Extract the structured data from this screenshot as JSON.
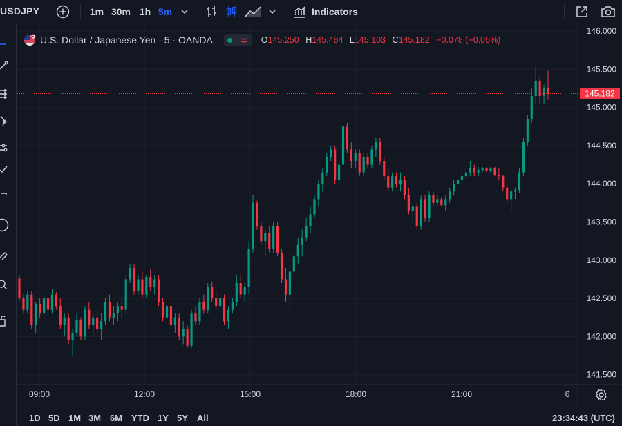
{
  "toolbar": {
    "symbol": "USDJPY",
    "timeframes": [
      "1m",
      "30m",
      "1h",
      "5m"
    ],
    "active_timeframe": "5m",
    "indicators_label": "Indicators"
  },
  "legend": {
    "title": "U.S. Dollar / Japanese Yen · 5 · OANDA",
    "o_label": "O",
    "o_value": "145.250",
    "h_label": "H",
    "h_value": "145.484",
    "l_label": "L",
    "l_value": "145.103",
    "c_label": "C",
    "c_value": "145.182",
    "change": "−0.078 (−0.05%)"
  },
  "ranges": [
    "1D",
    "5D",
    "1M",
    "3M",
    "6M",
    "YTD",
    "1Y",
    "5Y",
    "All"
  ],
  "clock": "23:34:43 (UTC)",
  "colors": {
    "up": "#089981",
    "down": "#f23645",
    "accent": "#2962ff",
    "bg": "#131722",
    "grid": "#1e222d"
  },
  "chart_data": {
    "type": "candlestick",
    "price_axis_labels": [
      "146.000",
      "145.500",
      "145.000",
      "144.500",
      "144.000",
      "143.500",
      "143.000",
      "142.500",
      "142.000",
      "141.500"
    ],
    "time_axis_labels": [
      "09:00",
      "12:00",
      "15:00",
      "18:00",
      "21:00",
      "6"
    ],
    "y_range": [
      141.45,
      146.0
    ],
    "last_price_label": "145.182",
    "candles": [
      [
        142.76,
        142.8,
        142.45,
        142.5
      ],
      [
        142.5,
        142.55,
        142.3,
        142.35
      ],
      [
        142.35,
        142.6,
        142.3,
        142.55
      ],
      [
        142.55,
        142.6,
        142.1,
        142.15
      ],
      [
        142.15,
        142.45,
        142.05,
        142.42
      ],
      [
        142.42,
        142.5,
        142.25,
        142.3
      ],
      [
        142.3,
        142.55,
        142.25,
        142.5
      ],
      [
        142.5,
        142.52,
        142.3,
        142.35
      ],
      [
        142.35,
        142.62,
        142.3,
        142.55
      ],
      [
        142.55,
        142.58,
        142.35,
        142.4
      ],
      [
        142.4,
        142.5,
        142.1,
        142.15
      ],
      [
        142.15,
        142.3,
        142.0,
        142.25
      ],
      [
        142.25,
        142.3,
        141.9,
        141.95
      ],
      [
        141.95,
        142.1,
        141.75,
        142.05
      ],
      [
        142.05,
        142.3,
        142.0,
        142.22
      ],
      [
        142.22,
        142.25,
        141.95,
        142.0
      ],
      [
        142.0,
        142.4,
        141.95,
        142.35
      ],
      [
        142.35,
        142.45,
        142.1,
        142.15
      ],
      [
        142.15,
        142.3,
        142.0,
        142.25
      ],
      [
        142.25,
        142.35,
        142.05,
        142.1
      ],
      [
        142.1,
        142.3,
        141.95,
        142.2
      ],
      [
        142.2,
        142.5,
        142.15,
        142.45
      ],
      [
        142.45,
        142.55,
        142.2,
        142.25
      ],
      [
        142.25,
        142.4,
        142.15,
        142.3
      ],
      [
        142.3,
        142.45,
        142.2,
        142.4
      ],
      [
        142.4,
        142.5,
        142.25,
        142.35
      ],
      [
        142.35,
        142.8,
        142.3,
        142.75
      ],
      [
        142.75,
        142.95,
        142.7,
        142.9
      ],
      [
        142.9,
        142.95,
        142.55,
        142.6
      ],
      [
        142.6,
        142.8,
        142.55,
        142.75
      ],
      [
        142.75,
        142.85,
        142.5,
        142.55
      ],
      [
        142.55,
        142.8,
        142.5,
        142.78
      ],
      [
        142.78,
        142.88,
        142.6,
        142.65
      ],
      [
        142.65,
        142.8,
        142.55,
        142.75
      ],
      [
        142.75,
        142.8,
        142.4,
        142.45
      ],
      [
        142.45,
        142.5,
        142.2,
        142.25
      ],
      [
        142.25,
        142.45,
        142.15,
        142.4
      ],
      [
        142.4,
        142.45,
        142.1,
        142.15
      ],
      [
        142.15,
        142.3,
        142.05,
        142.25
      ],
      [
        142.25,
        142.3,
        141.95,
        142.0
      ],
      [
        142.0,
        142.2,
        141.9,
        142.1
      ],
      [
        142.1,
        142.15,
        141.85,
        141.88
      ],
      [
        141.88,
        142.35,
        141.85,
        142.3
      ],
      [
        142.3,
        142.4,
        142.15,
        142.2
      ],
      [
        142.2,
        142.5,
        142.15,
        142.45
      ],
      [
        142.45,
        142.55,
        142.3,
        142.35
      ],
      [
        142.35,
        142.7,
        142.3,
        142.65
      ],
      [
        142.65,
        142.72,
        142.45,
        142.5
      ],
      [
        142.5,
        142.6,
        142.35,
        142.4
      ],
      [
        142.4,
        142.55,
        142.3,
        142.5
      ],
      [
        142.5,
        142.55,
        142.15,
        142.2
      ],
      [
        142.2,
        142.4,
        142.1,
        142.35
      ],
      [
        142.35,
        142.5,
        142.3,
        142.45
      ],
      [
        142.45,
        142.8,
        142.4,
        142.7
      ],
      [
        142.7,
        142.82,
        142.5,
        142.55
      ],
      [
        142.55,
        142.7,
        142.45,
        142.65
      ],
      [
        142.65,
        143.25,
        142.55,
        143.15
      ],
      [
        143.15,
        143.85,
        143.1,
        143.75
      ],
      [
        143.75,
        143.78,
        143.4,
        143.45
      ],
      [
        143.45,
        143.5,
        143.2,
        143.25
      ],
      [
        143.25,
        143.4,
        143.05,
        143.35
      ],
      [
        143.35,
        143.45,
        143.1,
        143.15
      ],
      [
        143.15,
        143.5,
        143.1,
        143.45
      ],
      [
        143.45,
        143.5,
        143.05,
        143.1
      ],
      [
        143.1,
        143.15,
        142.7,
        142.75
      ],
      [
        142.75,
        142.9,
        142.45,
        142.55
      ],
      [
        142.55,
        142.9,
        142.35,
        142.85
      ],
      [
        142.85,
        143.1,
        142.8,
        143.05
      ],
      [
        143.05,
        143.3,
        142.95,
        143.2
      ],
      [
        143.2,
        143.4,
        143.05,
        143.3
      ],
      [
        143.3,
        143.55,
        143.25,
        143.45
      ],
      [
        143.45,
        143.7,
        143.35,
        143.6
      ],
      [
        143.6,
        143.85,
        143.55,
        143.8
      ],
      [
        143.8,
        144.05,
        143.7,
        144.0
      ],
      [
        144.0,
        144.2,
        143.9,
        144.15
      ],
      [
        144.15,
        144.4,
        144.1,
        144.35
      ],
      [
        144.35,
        144.5,
        144.3,
        144.45
      ],
      [
        144.45,
        144.5,
        144.0,
        144.05
      ],
      [
        144.05,
        144.3,
        144.0,
        144.25
      ],
      [
        144.25,
        144.9,
        144.2,
        144.75
      ],
      [
        144.75,
        144.8,
        144.4,
        144.45
      ],
      [
        144.45,
        144.55,
        144.2,
        144.3
      ],
      [
        144.3,
        144.45,
        144.2,
        144.4
      ],
      [
        144.4,
        144.45,
        144.1,
        144.15
      ],
      [
        144.15,
        144.4,
        144.1,
        144.35
      ],
      [
        144.35,
        144.4,
        144.2,
        144.25
      ],
      [
        144.25,
        144.5,
        144.2,
        144.45
      ],
      [
        144.45,
        144.6,
        144.35,
        144.55
      ],
      [
        144.55,
        144.6,
        144.25,
        144.3
      ],
      [
        144.3,
        144.35,
        144.05,
        144.1
      ],
      [
        144.1,
        144.2,
        143.9,
        143.95
      ],
      [
        143.95,
        144.15,
        143.9,
        144.1
      ],
      [
        144.1,
        144.15,
        143.95,
        144.0
      ],
      [
        144.0,
        144.15,
        143.9,
        144.05
      ],
      [
        144.05,
        144.1,
        143.8,
        143.85
      ],
      [
        143.85,
        143.95,
        143.6,
        143.65
      ],
      [
        143.65,
        143.75,
        143.5,
        143.7
      ],
      [
        143.7,
        143.75,
        143.4,
        143.45
      ],
      [
        143.45,
        143.85,
        143.4,
        143.8
      ],
      [
        143.8,
        143.85,
        143.5,
        143.55
      ],
      [
        143.55,
        143.9,
        143.5,
        143.85
      ],
      [
        143.85,
        143.9,
        143.7,
        143.75
      ],
      [
        143.75,
        143.85,
        143.7,
        143.8
      ],
      [
        143.8,
        143.82,
        143.7,
        143.72
      ],
      [
        143.72,
        143.85,
        143.65,
        143.8
      ],
      [
        143.8,
        143.95,
        143.75,
        143.9
      ],
      [
        143.9,
        144.05,
        143.85,
        144.0
      ],
      [
        144.0,
        144.1,
        143.95,
        144.05
      ],
      [
        144.05,
        144.15,
        144.0,
        144.1
      ],
      [
        144.1,
        144.2,
        144.05,
        144.15
      ],
      [
        144.15,
        144.3,
        144.1,
        144.2
      ],
      [
        144.2,
        144.25,
        144.1,
        144.15
      ],
      [
        144.15,
        144.22,
        144.1,
        144.18
      ],
      [
        144.18,
        144.22,
        144.15,
        144.2
      ],
      [
        144.2,
        144.22,
        144.15,
        144.17
      ],
      [
        144.17,
        144.22,
        144.14,
        144.2
      ],
      [
        144.2,
        144.22,
        144.1,
        144.12
      ],
      [
        144.12,
        144.2,
        144.05,
        144.1
      ],
      [
        144.1,
        144.12,
        143.9,
        143.95
      ],
      [
        143.95,
        144.0,
        143.75,
        143.8
      ],
      [
        143.8,
        143.95,
        143.65,
        143.9
      ],
      [
        143.9,
        143.95,
        143.8,
        143.92
      ],
      [
        143.92,
        144.2,
        143.88,
        144.15
      ],
      [
        144.15,
        144.6,
        144.1,
        144.55
      ],
      [
        144.55,
        144.9,
        144.5,
        144.85
      ],
      [
        144.85,
        145.25,
        144.8,
        145.15
      ],
      [
        145.15,
        145.55,
        145.05,
        145.35
      ],
      [
        145.35,
        145.4,
        145.05,
        145.15
      ],
      [
        145.15,
        145.3,
        145.05,
        145.25
      ],
      [
        145.25,
        145.48,
        145.1,
        145.18
      ]
    ]
  }
}
